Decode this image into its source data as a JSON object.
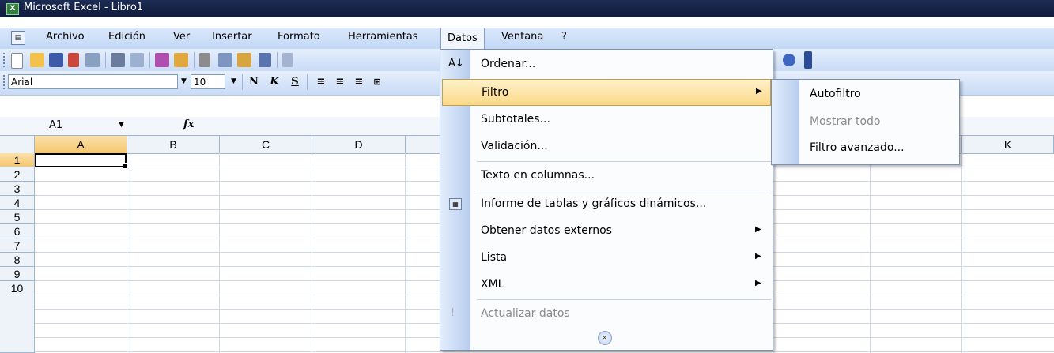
{
  "window": {
    "title": "Microsoft Excel - Libro1",
    "app_icon": "excel-icon"
  },
  "menubar": {
    "items": [
      {
        "label": "Archivo"
      },
      {
        "label": "Edición"
      },
      {
        "label": "Ver"
      },
      {
        "label": "Insertar"
      },
      {
        "label": "Formato"
      },
      {
        "label": "Herramientas"
      },
      {
        "label": "Datos",
        "active": true
      },
      {
        "label": "Ventana"
      },
      {
        "label": "?"
      }
    ]
  },
  "format_toolbar": {
    "font_name": "Arial",
    "font_size": "10",
    "bold_label": "N",
    "italic_label": "K",
    "underline_label": "S"
  },
  "formula_bar": {
    "name_box": "A1",
    "fx_label": "fx",
    "formula": ""
  },
  "grid": {
    "columns": [
      "A",
      "B",
      "C",
      "D",
      "K"
    ],
    "rows": [
      "1",
      "2",
      "3",
      "4",
      "5",
      "6",
      "7",
      "8",
      "9",
      "10"
    ],
    "active_cell": "A1"
  },
  "datos_menu": {
    "items": [
      {
        "label": "Ordenar...",
        "icon": "sort-az-icon"
      },
      {
        "label": "Filtro",
        "submenu": true,
        "highlighted": true
      },
      {
        "label": "Subtotales..."
      },
      {
        "label": "Validación..."
      },
      {
        "label": "Texto en columnas..."
      },
      {
        "label": "Informe de tablas y gráficos dinámicos...",
        "icon": "pivot-table-icon"
      },
      {
        "label": "Obtener datos externos",
        "submenu": true
      },
      {
        "label": "Lista",
        "submenu": true
      },
      {
        "label": "XML",
        "submenu": true
      },
      {
        "label": "Actualizar datos",
        "disabled": true,
        "icon": "refresh-icon"
      }
    ],
    "expand_icon": "chevron-double-down-icon"
  },
  "filtro_submenu": {
    "items": [
      {
        "label": "Autofiltro"
      },
      {
        "label": "Mostrar todo",
        "disabled": true
      },
      {
        "label": "Filtro avanzado..."
      }
    ]
  },
  "colors": {
    "highlight": "#fbd98a",
    "title_bar": "#0e1a3a",
    "menu_bar": "#c3d8f6"
  }
}
